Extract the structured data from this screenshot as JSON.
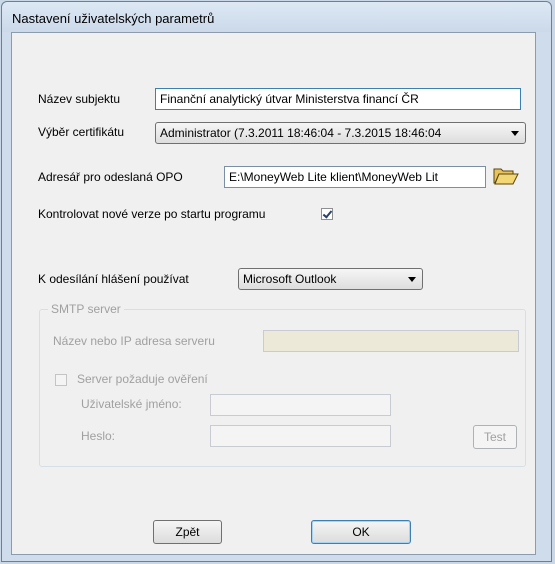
{
  "window": {
    "title": "Nastavení uživatelských parametrů"
  },
  "form": {
    "subject_label": "Název subjektu",
    "subject_value": "Finanční analytický útvar Ministerstva financí ČR",
    "cert_label": "Výběr certifikátu",
    "cert_value": "Administrator (7.3.2011 18:46:04 - 7.3.2015 18:46:04",
    "dir_label": "Adresář pro odeslaná OPO",
    "dir_value": "E:\\MoneyWeb Lite klient\\MoneyWeb Lit",
    "check_versions_label": "Kontrolovat nové verze po startu programu",
    "check_versions_checked": true,
    "send_label": "K odesílání hlášení používat",
    "send_value": "Microsoft Outlook"
  },
  "smtp": {
    "legend": "SMTP server",
    "server_label": "Název nebo IP adresa serveru",
    "server_value": "",
    "auth_label": "Server požaduje ověření",
    "user_label": "Uživatelské jméno:",
    "password_label": "Heslo:",
    "test_label": "Test"
  },
  "buttons": {
    "back": "Zpět",
    "ok": "OK"
  }
}
